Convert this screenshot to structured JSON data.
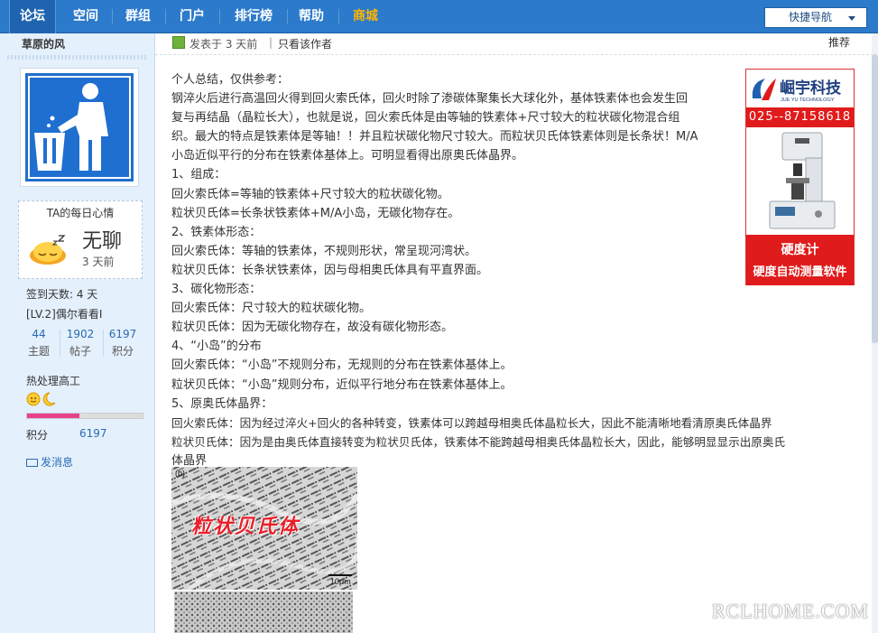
{
  "nav": {
    "items": [
      {
        "label": "论坛",
        "active": true
      },
      {
        "label": "空间"
      },
      {
        "label": "群组"
      },
      {
        "label": "门户"
      },
      {
        "label": "排行榜"
      },
      {
        "label": "帮助"
      },
      {
        "label": "商城",
        "highlight_color": "#ffb400"
      }
    ],
    "quick_nav_label": "快捷导航"
  },
  "author": {
    "name": "草原的风",
    "mood": {
      "title": "TA的每日心情",
      "word": "无聊",
      "time": "3 天前"
    },
    "checkin_days": "签到天数: 4 天",
    "level": "[LV.2]偶尔看看I",
    "stats": [
      {
        "value": "44",
        "label": "主题"
      },
      {
        "value": "1902",
        "label": "帖子"
      },
      {
        "value": "6197",
        "label": "积分"
      }
    ],
    "rank_title": "热处理高工",
    "progress_fraction": 0.45,
    "points_label": "积分",
    "points_value": "6197",
    "message_link": "发消息"
  },
  "post_header": {
    "posted_at": "发表于 3 天前",
    "separator": "|",
    "only_author": "只看该作者",
    "recommend": "推荐"
  },
  "post": {
    "lines": [
      "个人总结，仅供参考：",
      "钢淬火后进行高温回火得到回火索氏体，回火时除了渗碳体聚集长大球化外，基体铁素体也会发生回",
      "复与再结晶（晶粒长大），也就是说，回火索氏体是由等轴的铁素体+尺寸较大的粒状碳化物混合组",
      "织。最大的特点是铁素体是等轴！！并且粒状碳化物尺寸较大。而粒状贝氏体铁素体则是长条状！M/A",
      "小岛近似平行的分布在铁素体基体上。可明显看得出原奥氏体晶界。",
      "1、组成：",
      "回火索氏体=等轴的铁素体+尺寸较大的粒状碳化物。",
      "粒状贝氏体=长条状铁素体+M/A小岛，无碳化物存在。",
      "2、铁素体形态：",
      "回火索氏体：等轴的铁素体，不规则形状，常呈现河湾状。",
      "粒状贝氏体：长条状铁素体，因与母相奥氏体具有平直界面。",
      "3、碳化物形态：",
      "回火索氏体：尺寸较大的粒状碳化物。",
      "粒状贝氏体：因为无碳化物存在，故没有碳化物形态。",
      "4、“小岛”的分布",
      "回火索氏体：“小岛”不规则分布，无规则的分布在铁素体基体上。",
      "粒状贝氏体：“小岛”规则分布，近似平行地分布在铁素体基体上。",
      "5、原奥氏体晶界：",
      "回火索氏体：因为经过淬火+回火的各种转变，铁素体可以跨越母相奥氏体晶粒长大，因此不能清晰地看清原奥氏体晶界",
      "粒状贝氏体：因为是由奥氏体直接转变为粒状贝氏体，铁素体不能跨越母相奥氏体晶粒长大，因此，能够明显显示出原奥氏",
      "体晶界"
    ],
    "image1": {
      "corner_label": "(b)",
      "overlay_text": "粒状贝氏体",
      "scale": "10μm"
    }
  },
  "ad": {
    "brand": "崛宇科技",
    "brand_en": "JUE YU TECHNOLOGY",
    "phone": "025--87158618",
    "line1": "硬度计",
    "line2": "硬度自动测量软件"
  },
  "watermark": "RCLHOME.COM",
  "colors": {
    "nav_bg": "#2b7acb",
    "sidebar_bg": "#e4f0fc",
    "accent_red": "#e01b1b",
    "progress_pink": "#e6438a"
  }
}
